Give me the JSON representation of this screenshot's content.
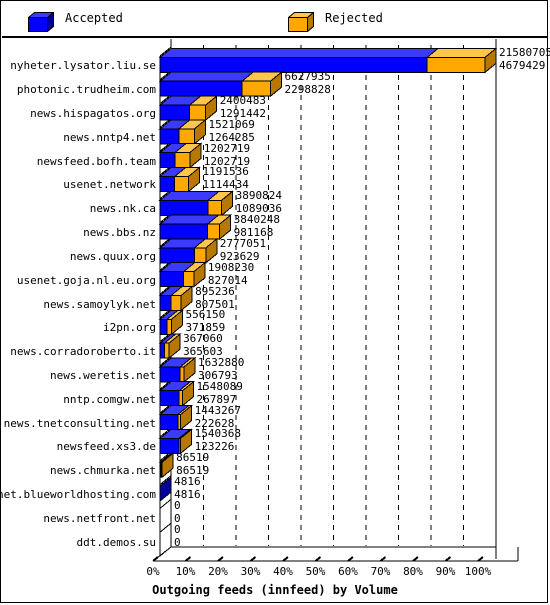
{
  "legend": {
    "accepted": {
      "label": "Accepted",
      "color": "#0000ff",
      "icon": "cube-icon"
    },
    "rejected": {
      "label": "Rejected",
      "color": "#ffa900",
      "icon": "cube-icon"
    }
  },
  "chart_data": {
    "type": "bar",
    "orientation": "horizontal",
    "stacked": true,
    "title": "Outgoing feeds (innfeed) by Volume",
    "xlabel": "Outgoing feeds (innfeed) by Volume",
    "ylabel": "",
    "xlim": [
      0,
      100
    ],
    "xunit": "%",
    "grid": true,
    "grid_style": "dashed-vertical",
    "legend_position": "top",
    "tick_labels": [
      "0%",
      "10%",
      "20%",
      "30%",
      "40%",
      "50%",
      "60%",
      "70%",
      "80%",
      "90%",
      "100%"
    ],
    "tick_values": [
      0,
      10,
      20,
      30,
      40,
      50,
      60,
      70,
      80,
      90,
      100
    ],
    "categories": [
      "nyheter.lysator.liu.se",
      "photonic.trudheim.com",
      "news.hispagatos.org",
      "news.nntp4.net",
      "newsfeed.bofh.team",
      "usenet.network",
      "news.nk.ca",
      "news.bbs.nz",
      "news.quux.org",
      "usenet.goja.nl.eu.org",
      "news.samoylyk.net",
      "i2pn.org",
      "news.corradoroberto.it",
      "news.weretis.net",
      "nntp.comgw.net",
      "news.tnetconsulting.net",
      "newsfeed.xs3.de",
      "news.chmurka.net",
      "usenet.blueworldhosting.com",
      "news.netfront.net",
      "ddt.demos.su"
    ],
    "series": [
      {
        "name": "Accepted",
        "color": "#0000ff",
        "values": [
          21580705,
          6627935,
          2400483,
          1521069,
          1202719,
          1191536,
          3890824,
          3840248,
          2777051,
          1908230,
          895236,
          556150,
          367060,
          1632880,
          1548089,
          1443267,
          1540368,
          86519,
          4816,
          0,
          0
        ]
      },
      {
        "name": "Rejected",
        "color": "#ffa900",
        "values": [
          4679429,
          2298828,
          1291442,
          1264285,
          1202719,
          1114434,
          1089036,
          981168,
          923629,
          827014,
          807501,
          371859,
          365603,
          306793,
          267897,
          222628,
          123226,
          86519,
          4816,
          0,
          0
        ]
      }
    ],
    "rows": [
      {
        "label": "nyheter.lysator.liu.se",
        "accepted": 21580705,
        "rejected": 4679429,
        "accepted_text": "21580705",
        "rejected_text": "4679429"
      },
      {
        "label": "photonic.trudheim.com",
        "accepted": 6627935,
        "rejected": 2298828,
        "accepted_text": "6627935",
        "rejected_text": "2298828"
      },
      {
        "label": "news.hispagatos.org",
        "accepted": 2400483,
        "rejected": 1291442,
        "accepted_text": "2400483",
        "rejected_text": "1291442"
      },
      {
        "label": "news.nntp4.net",
        "accepted": 1521069,
        "rejected": 1264285,
        "accepted_text": "1521069",
        "rejected_text": "1264285"
      },
      {
        "label": "newsfeed.bofh.team",
        "accepted": 1202719,
        "rejected": 1202719,
        "accepted_text": "1202719",
        "rejected_text": "1202719"
      },
      {
        "label": "usenet.network",
        "accepted": 1191536,
        "rejected": 1114434,
        "accepted_text": "1191536",
        "rejected_text": "1114434"
      },
      {
        "label": "news.nk.ca",
        "accepted": 3890824,
        "rejected": 1089036,
        "accepted_text": "3890824",
        "rejected_text": "1089036"
      },
      {
        "label": "news.bbs.nz",
        "accepted": 3840248,
        "rejected": 981168,
        "accepted_text": "3840248",
        "rejected_text": "981168"
      },
      {
        "label": "news.quux.org",
        "accepted": 2777051,
        "rejected": 923629,
        "accepted_text": "2777051",
        "rejected_text": "923629"
      },
      {
        "label": "usenet.goja.nl.eu.org",
        "accepted": 1908230,
        "rejected": 827014,
        "accepted_text": "1908230",
        "rejected_text": "827014"
      },
      {
        "label": "news.samoylyk.net",
        "accepted": 895236,
        "rejected": 807501,
        "accepted_text": "895236",
        "rejected_text": "807501"
      },
      {
        "label": "i2pn.org",
        "accepted": 556150,
        "rejected": 371859,
        "accepted_text": "556150",
        "rejected_text": "371859"
      },
      {
        "label": "news.corradoroberto.it",
        "accepted": 367060,
        "rejected": 365603,
        "accepted_text": "367060",
        "rejected_text": "365603"
      },
      {
        "label": "news.weretis.net",
        "accepted": 1632880,
        "rejected": 306793,
        "accepted_text": "1632880",
        "rejected_text": "306793"
      },
      {
        "label": "nntp.comgw.net",
        "accepted": 1548089,
        "rejected": 267897,
        "accepted_text": "1548089",
        "rejected_text": "267897"
      },
      {
        "label": "news.tnetconsulting.net",
        "accepted": 1443267,
        "rejected": 222628,
        "accepted_text": "1443267",
        "rejected_text": "222628"
      },
      {
        "label": "newsfeed.xs3.de",
        "accepted": 1540368,
        "rejected": 123226,
        "accepted_text": "1540368",
        "rejected_text": "123226"
      },
      {
        "label": "news.chmurka.net",
        "accepted": 86519,
        "rejected": 86519,
        "accepted_text": "86519",
        "rejected_text": "86519"
      },
      {
        "label": "usenet.blueworldhosting.com",
        "accepted": 4816,
        "rejected": 4816,
        "accepted_text": "4816",
        "rejected_text": "4816"
      },
      {
        "label": "news.netfront.net",
        "accepted": 0,
        "rejected": 0,
        "accepted_text": "0",
        "rejected_text": "0"
      },
      {
        "label": "ddt.demos.su",
        "accepted": 0,
        "rejected": 0,
        "accepted_text": "0",
        "rejected_text": "0"
      }
    ]
  }
}
